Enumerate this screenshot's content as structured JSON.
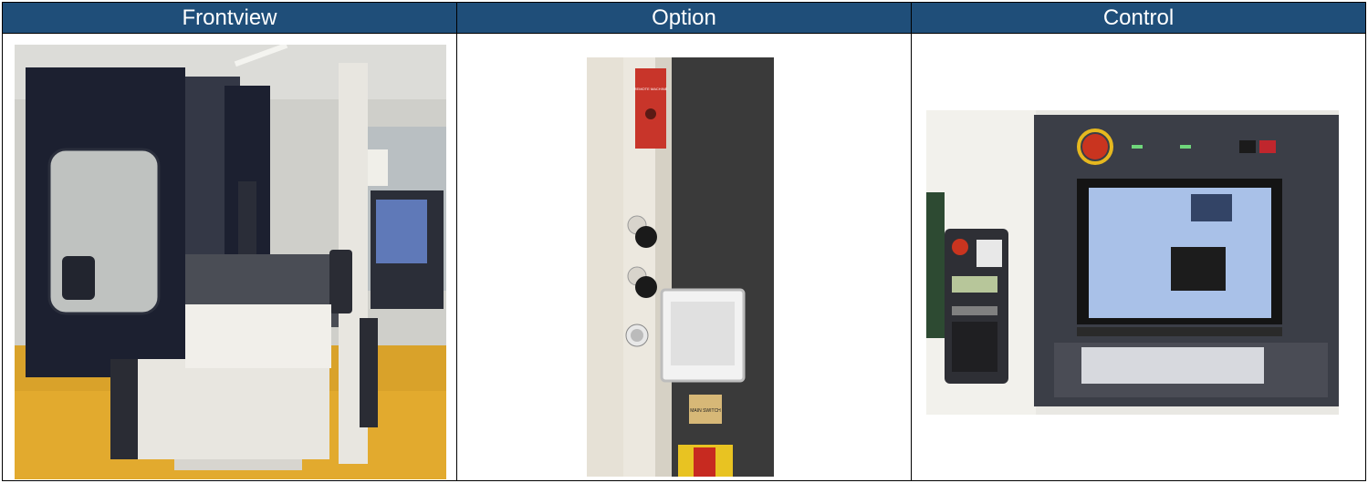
{
  "columns": [
    {
      "title": "Frontview",
      "photo": "edm-machine-front-photo"
    },
    {
      "title": "Option",
      "photo": "machine-side-panel-photo"
    },
    {
      "title": "Control",
      "photo": "control-panel-photo"
    }
  ],
  "option_panel": {
    "emergency_label": "REMOTE MACHINE",
    "main_switch_label": "MAIN SWITCH"
  },
  "colors": {
    "header_bg": "#1f4e79",
    "header_text": "#ffffff",
    "machine_navy": "#1c2030",
    "machine_white": "#e8e6e0",
    "floor_orange": "#e2a21e"
  }
}
